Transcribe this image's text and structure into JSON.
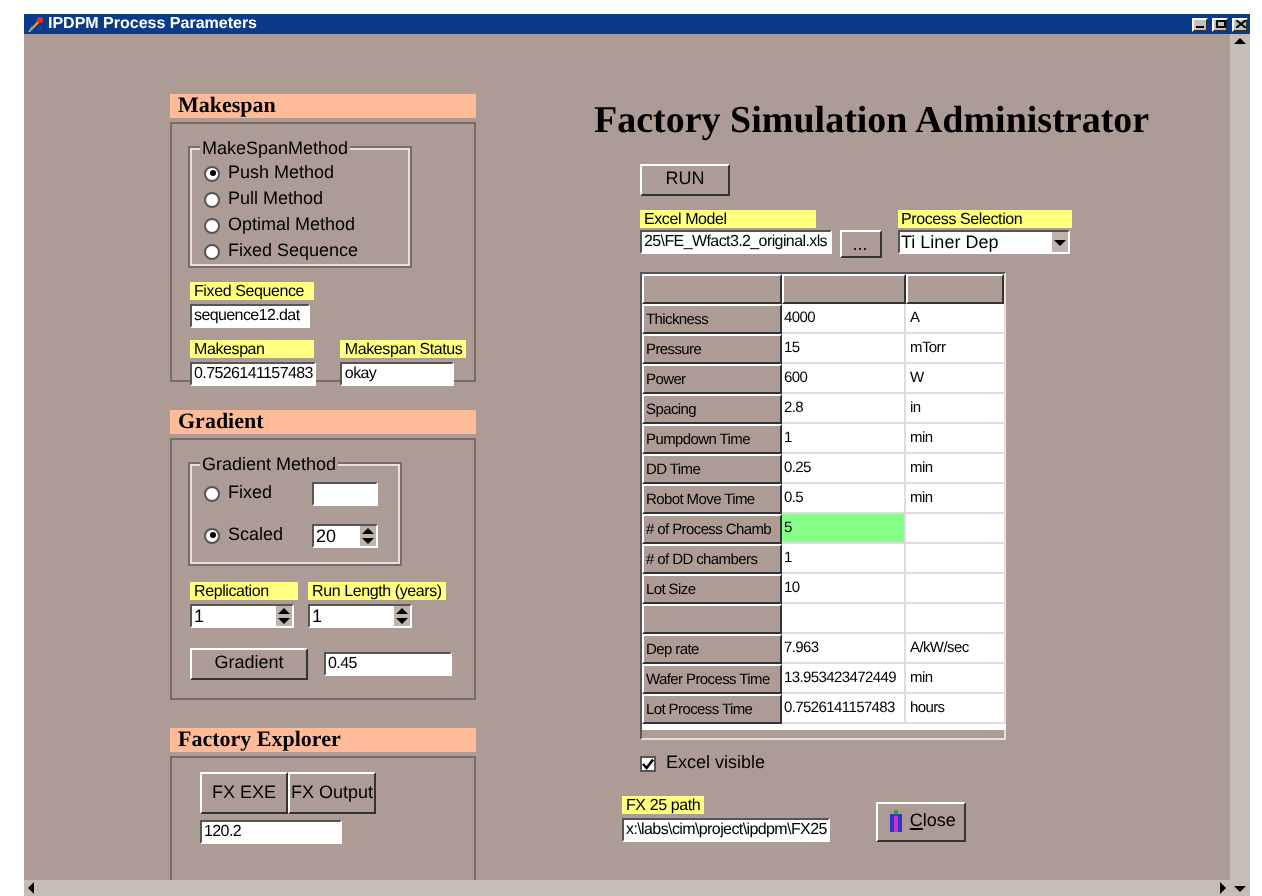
{
  "window": {
    "title": "IPDPM Process Parameters"
  },
  "heading": "Factory Simulation Administrator",
  "makespan": {
    "header": "Makespan",
    "method_group": "MakeSpanMethod",
    "methods": [
      {
        "label": "Push Method",
        "selected": true
      },
      {
        "label": "Pull Method",
        "selected": false
      },
      {
        "label": "Optimal Method",
        "selected": false
      },
      {
        "label": "Fixed Sequence",
        "selected": false
      }
    ],
    "fixed_sequence": {
      "label": "Fixed Sequence",
      "value": "sequence12.dat"
    },
    "makespan": {
      "label": "Makespan",
      "value": "0.7526141157483"
    },
    "status": {
      "label": "Makespan Status",
      "value": "okay"
    }
  },
  "gradient": {
    "header": "Gradient",
    "method_group": "Gradient Method",
    "methods": [
      {
        "label": "Fixed",
        "selected": false,
        "kind": "text"
      },
      {
        "label": "Scaled",
        "selected": true,
        "kind": "spin",
        "value": "20"
      }
    ],
    "replication": {
      "label": "Replication",
      "value": "1"
    },
    "run_length": {
      "label": "Run Length (years)",
      "value": "1"
    },
    "button": "Gradient",
    "result": "0.45"
  },
  "factory_explorer": {
    "header": "Factory Explorer",
    "buttons": [
      "FX EXE",
      "FX Output"
    ],
    "value": "120.2"
  },
  "run_button": "RUN",
  "excel_model": {
    "label": "Excel Model",
    "value": "25\\FE_Wfact3.2_original.xls",
    "browse": "..."
  },
  "process_selection": {
    "label": "Process Selection",
    "value": "Ti Liner Dep"
  },
  "table": {
    "rows": [
      {
        "kind": "data",
        "label": "Thickness",
        "value": "4000",
        "unit": "A",
        "highlighted": false
      },
      {
        "kind": "data",
        "label": "Pressure",
        "value": "15",
        "unit": "mTorr",
        "highlighted": false
      },
      {
        "kind": "data",
        "label": "Power",
        "value": "600",
        "unit": "W",
        "highlighted": false
      },
      {
        "kind": "data",
        "label": "Spacing",
        "value": "2.8",
        "unit": "in",
        "highlighted": false
      },
      {
        "kind": "data",
        "label": "Pumpdown Time",
        "value": "1",
        "unit": "min",
        "highlighted": false
      },
      {
        "kind": "data",
        "label": "DD Time",
        "value": "0.25",
        "unit": "min",
        "highlighted": false
      },
      {
        "kind": "data",
        "label": "Robot Move Time",
        "value": "0.5",
        "unit": "min",
        "highlighted": false
      },
      {
        "kind": "data",
        "label": "# of Process Chamb",
        "value": "5",
        "highlighted": true
      },
      {
        "kind": "data",
        "label": "# of DD chambers",
        "value": "1",
        "highlighted": false
      },
      {
        "kind": "data",
        "label": "Lot Size",
        "value": "10",
        "highlighted": false
      },
      {
        "kind": "blank",
        "highlighted": false
      },
      {
        "kind": "data",
        "label": "Dep rate",
        "value": "7.963",
        "unit": "A/kW/sec",
        "highlighted": false
      },
      {
        "kind": "data",
        "label": "Wafer Process Time",
        "value": "13.953423472449",
        "unit": "min",
        "highlighted": false
      },
      {
        "kind": "data",
        "label": "Lot Process Time",
        "value": "0.7526141157483",
        "unit": "hours",
        "highlighted": false
      }
    ]
  },
  "excel_visible": {
    "label": "Excel visible",
    "checked": true
  },
  "fx25_path": {
    "label": "FX 25 path",
    "value": "x:\\labs\\cim\\project\\ipdpm\\FX25"
  },
  "close_button": "Close"
}
